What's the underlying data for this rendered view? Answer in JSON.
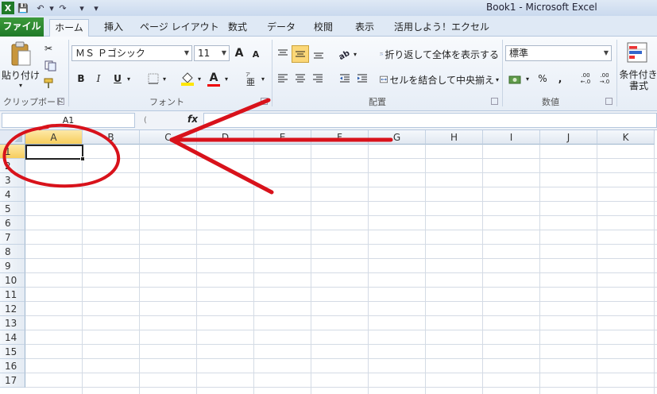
{
  "title_bar": {
    "app_title": "Book1 - Microsoft Excel",
    "quick_access": [
      {
        "name": "excel-logo-icon",
        "glyph": "X"
      },
      {
        "name": "save-icon",
        "glyph": "💾"
      },
      {
        "name": "undo-icon",
        "glyph": "↶"
      },
      {
        "name": "undo-dropdown-icon",
        "glyph": "▾"
      },
      {
        "name": "redo-icon",
        "glyph": "↷"
      },
      {
        "name": "redo-dropdown-icon",
        "glyph": "▾"
      },
      {
        "name": "customize-qat-icon",
        "glyph": "▾"
      }
    ]
  },
  "tabs": [
    "ファイル",
    "ホーム",
    "挿入",
    "ページ レイアウト",
    "数式",
    "データ",
    "校閲",
    "表示",
    "活用しよう！エクセル"
  ],
  "ribbon": {
    "clipboard": {
      "paste": "貼り付け",
      "label": "クリップボード"
    },
    "font": {
      "name": "ＭＳ Ｐゴシック",
      "size": "11",
      "grow": "A",
      "shrink": "A",
      "bold": "B",
      "italic": "I",
      "underline": "U",
      "font_color_letter": "A",
      "label": "フォント"
    },
    "alignment": {
      "wrap": "折り返して全体を表示する",
      "merge": "セルを結合して中央揃え",
      "label": "配置"
    },
    "number": {
      "format": "標準",
      "percent": "%",
      "comma": ",",
      "inc_decimal": ".00",
      "dec_decimal": ".00",
      "label": "数値"
    },
    "styles": {
      "cond_format_1": "条件付き",
      "cond_format_2": "書式"
    }
  },
  "formula_bar": {
    "name_box": "A1",
    "fx": "fx",
    "value": ""
  },
  "grid": {
    "columns": [
      "A",
      "B",
      "C",
      "D",
      "E",
      "F",
      "G",
      "H",
      "I",
      "J",
      "K"
    ],
    "rows": [
      "1",
      "2",
      "3",
      "4",
      "5",
      "6",
      "7",
      "8",
      "9",
      "10",
      "11",
      "12",
      "13",
      "14",
      "15",
      "16",
      "17"
    ],
    "selected_column": "A",
    "selected_row": "1"
  },
  "annotation": {
    "color": "#d8121b"
  },
  "colors": {
    "file_tab": "#2a8a30",
    "accent": "#f7cd5c"
  }
}
